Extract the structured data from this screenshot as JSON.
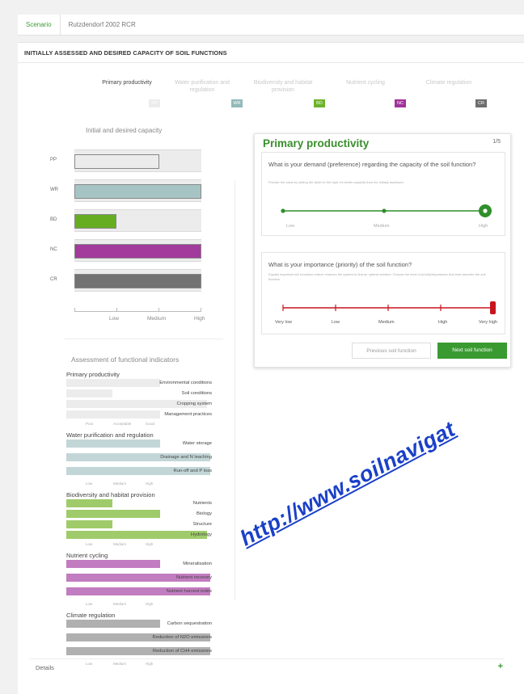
{
  "tabs": [
    {
      "label": "Scenario"
    },
    {
      "label": "Rutzdendorf 2002 RCR"
    }
  ],
  "panel": {
    "title": "INITIALLY ASSESSED AND DESIRED CAPACITY OF SOIL FUNCTIONS"
  },
  "functions": [
    {
      "name": "Primary productivity",
      "code": "PP",
      "color": "#d0d0d0",
      "active": true
    },
    {
      "name": "Water purification and regulation",
      "code": "WR",
      "color": "#93b9b9",
      "active": false
    },
    {
      "name": "Biodiversity and habitat provision",
      "code": "BD",
      "color": "#6db32a",
      "active": false
    },
    {
      "name": "Nutrient cycling",
      "code": "NC",
      "color": "#a0339a",
      "active": false
    },
    {
      "name": "Climate regulation",
      "code": "CR",
      "color": "#6e6e6e",
      "active": false
    }
  ],
  "capacity_chart": {
    "title": "Initial and desired capacity",
    "scale": [
      "Low",
      "Medium",
      "High"
    ],
    "rows": [
      {
        "code": "PP",
        "value": 0.67,
        "fill": "#ececec"
      },
      {
        "code": "WR",
        "value": 1.0,
        "fill": "#a7c4c5"
      },
      {
        "code": "BD",
        "value": 0.33,
        "fill": "#66ad22"
      },
      {
        "code": "NC",
        "value": 1.0,
        "fill": "#a23b9c"
      },
      {
        "code": "CR",
        "value": 1.0,
        "fill": "#727272"
      }
    ]
  },
  "indicators": {
    "title": "Assessment of functional indicators",
    "groups": [
      {
        "name": "Primary productivity",
        "color": "#ececec",
        "scale": [
          "Poor",
          "Acceptable",
          "Good"
        ],
        "items": [
          {
            "label": "Environmental conditions",
            "value": 0.65
          },
          {
            "label": "Soil conditions",
            "value": 0.32
          },
          {
            "label": "Cropping system",
            "value": 0.98
          },
          {
            "label": "Management practices",
            "value": 0.65
          }
        ]
      },
      {
        "name": "Water purification and regulation",
        "color": "#c3d6d7",
        "scale": [
          "Low",
          "Medium",
          "High"
        ],
        "items": [
          {
            "label": "Water storage",
            "value": 0.65
          },
          {
            "label": "Drainage and N leaching",
            "value": 1.0
          },
          {
            "label": "Run-off and P loss",
            "value": 1.0
          }
        ]
      },
      {
        "name": "Biodiversity and habitat provision",
        "color": "#9fcb6a",
        "scale": [
          "Low",
          "Medium",
          "High"
        ],
        "items": [
          {
            "label": "Nutrients",
            "value": 0.32
          },
          {
            "label": "Biology",
            "value": 0.65
          },
          {
            "label": "Structure",
            "value": 0.32
          },
          {
            "label": "Hydrology",
            "value": 0.98
          }
        ]
      },
      {
        "name": "Nutrient cycling",
        "color": "#c27cc0",
        "scale": [
          "Low",
          "Medium",
          "High"
        ],
        "items": [
          {
            "label": "Mineralisation",
            "value": 0.65
          },
          {
            "label": "Nutrient recovery",
            "value": 1.0
          },
          {
            "label": "Nutrient harvest index",
            "value": 1.0
          }
        ]
      },
      {
        "name": "Climate regulation",
        "color": "#b0b0b0",
        "scale": [
          "Low",
          "Medium",
          "High"
        ],
        "items": [
          {
            "label": "Carbon sequestration",
            "value": 0.65
          },
          {
            "label": "Reduction of N2O emissions",
            "value": 1.0
          },
          {
            "label": "Reduction of CH4 emissions",
            "value": 1.0
          }
        ]
      }
    ]
  },
  "card": {
    "title": "Primary productivity",
    "counter": "1/5",
    "demand": {
      "question": "What is your demand (preference) regarding the capacity of the soil function?",
      "help": "Provide the value by sliding the slider to the right, for better capacity than the initially assessed.",
      "labels": [
        "Low",
        "Medium",
        "High"
      ],
      "value": 1.0,
      "color": "#2f8f2a"
    },
    "importance": {
      "question": "What is your importance (priority) of the soil function?",
      "help": "Equally important soil functions reduce chances the system to find an optimal solution. Choose the level of priority/importance that best describe the soil function.",
      "labels": [
        "Very low",
        "Low",
        "Medium",
        "High",
        "Very high"
      ],
      "value": 1.0,
      "color": "#c8141e"
    },
    "prev_button": "Previous soil function",
    "next_button": "Next soil function"
  },
  "details": {
    "label": "Details",
    "plus": "+"
  },
  "watermark": "http://www.soilnavigat"
}
